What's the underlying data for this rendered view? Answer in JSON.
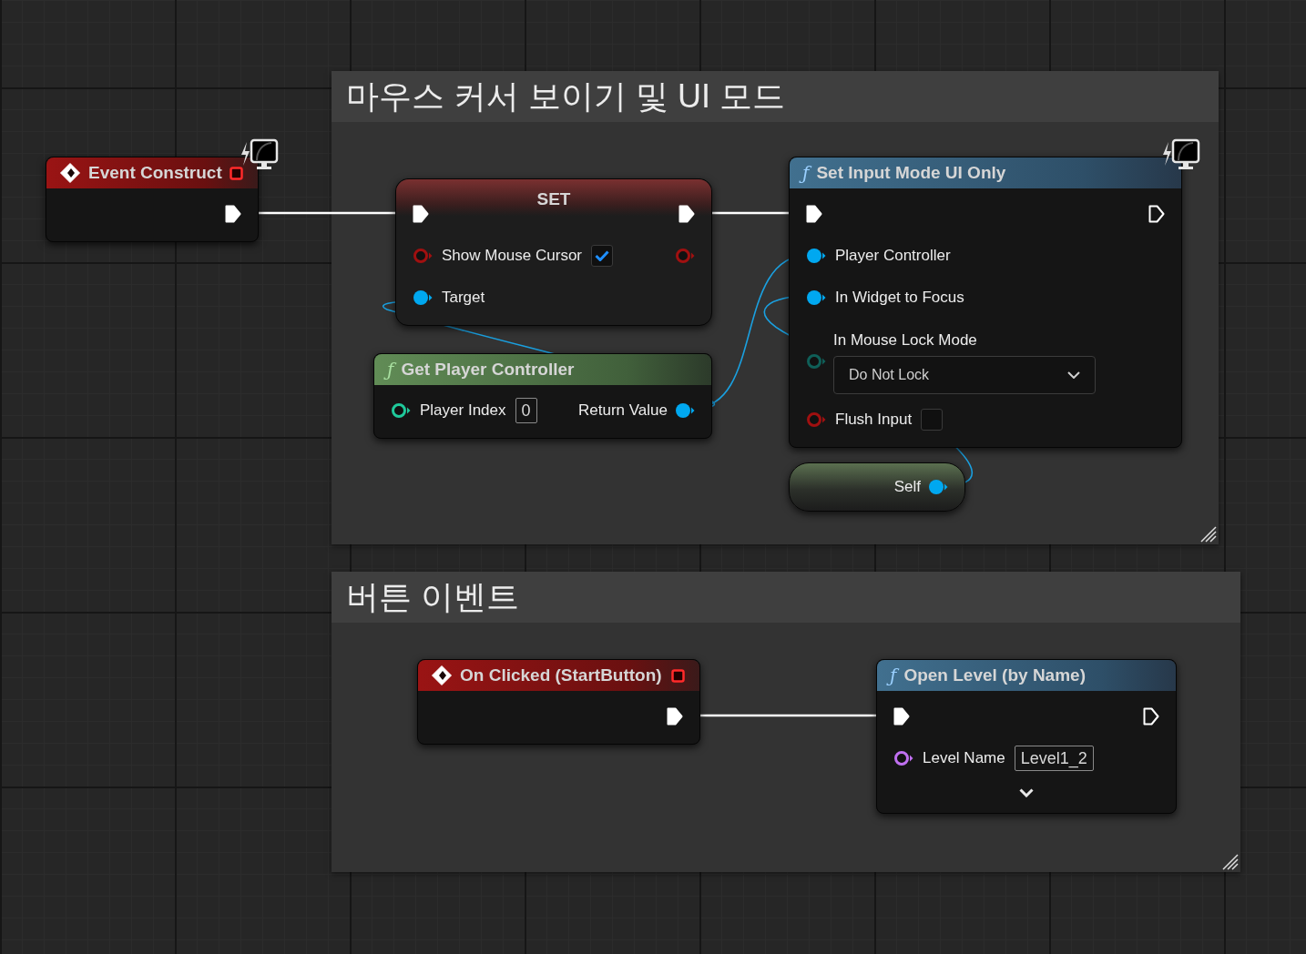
{
  "comments": [
    {
      "title": "마우스 커서 보이기 및 UI 모드"
    },
    {
      "title": "버튼 이벤트"
    }
  ],
  "nodes": [
    {
      "kind": "event",
      "title": "Event Construct",
      "client_only": true,
      "rows": [
        {
          "right": {
            "kind": "exec",
            "connected": true
          }
        }
      ]
    },
    {
      "kind": "set",
      "title": "SET",
      "rows": [
        {
          "left": {
            "kind": "exec",
            "connected": true
          },
          "right": {
            "kind": "exec",
            "connected": true
          }
        },
        {
          "left": {
            "kind": "data",
            "color": "#a01010",
            "connected": false,
            "label": "Show Mouse Cursor",
            "widget": {
              "kind": "checkbox",
              "checked": true
            }
          },
          "right": {
            "kind": "data",
            "color": "#a01010",
            "connected": false
          }
        },
        {
          "left": {
            "kind": "data",
            "color": "#00a8f0",
            "connected": true,
            "label": "Target"
          }
        }
      ]
    },
    {
      "kind": "pure",
      "title": "Get Player Controller",
      "glyph": "ƒ",
      "rows": [
        {
          "left": {
            "kind": "data",
            "color": "#1fc99b",
            "connected": false,
            "label": "Player Index",
            "widget": {
              "kind": "text",
              "value": "0"
            }
          },
          "right": {
            "kind": "data",
            "color": "#00a8f0",
            "connected": true,
            "label": "Return Value"
          }
        }
      ]
    },
    {
      "kind": "function",
      "title": "Set Input Mode UI Only",
      "glyph": "ƒ",
      "client_only": true,
      "rows": [
        {
          "left": {
            "kind": "exec",
            "connected": true
          },
          "right": {
            "kind": "exec",
            "connected": false
          }
        },
        {
          "left": {
            "kind": "data",
            "color": "#00a8f0",
            "connected": true,
            "label": "Player Controller"
          }
        },
        {
          "left": {
            "kind": "data",
            "color": "#00a8f0",
            "connected": true,
            "label": "In Widget to Focus"
          }
        },
        {
          "left": {
            "kind": "data",
            "color": "#0f5f58",
            "connected": false,
            "label": "In Mouse Lock Mode",
            "widget": {
              "kind": "dropdown",
              "value": "Do Not Lock"
            }
          }
        },
        {
          "left": {
            "kind": "data",
            "color": "#a01010",
            "connected": false,
            "label": "Flush Input",
            "widget": {
              "kind": "checkbox",
              "checked": false
            }
          }
        }
      ]
    },
    {
      "kind": "self",
      "rows": [
        {
          "right": {
            "kind": "data",
            "color": "#00a8f0",
            "connected": true,
            "label": "Self"
          }
        }
      ]
    },
    {
      "kind": "event",
      "title": "On Clicked (StartButton)",
      "client_only": false,
      "rows": [
        {
          "right": {
            "kind": "exec",
            "connected": true
          }
        }
      ]
    },
    {
      "kind": "function",
      "title": "Open Level (by Name)",
      "glyph": "ƒ",
      "collapsed_advanced": true,
      "rows": [
        {
          "left": {
            "kind": "exec",
            "connected": true
          },
          "right": {
            "kind": "exec",
            "connected": false
          }
        },
        {
          "left": {
            "kind": "data",
            "color": "#c070f0",
            "connected": false,
            "label": "Level Name",
            "widget": {
              "kind": "text",
              "value": "Level1_2"
            }
          }
        }
      ]
    }
  ]
}
